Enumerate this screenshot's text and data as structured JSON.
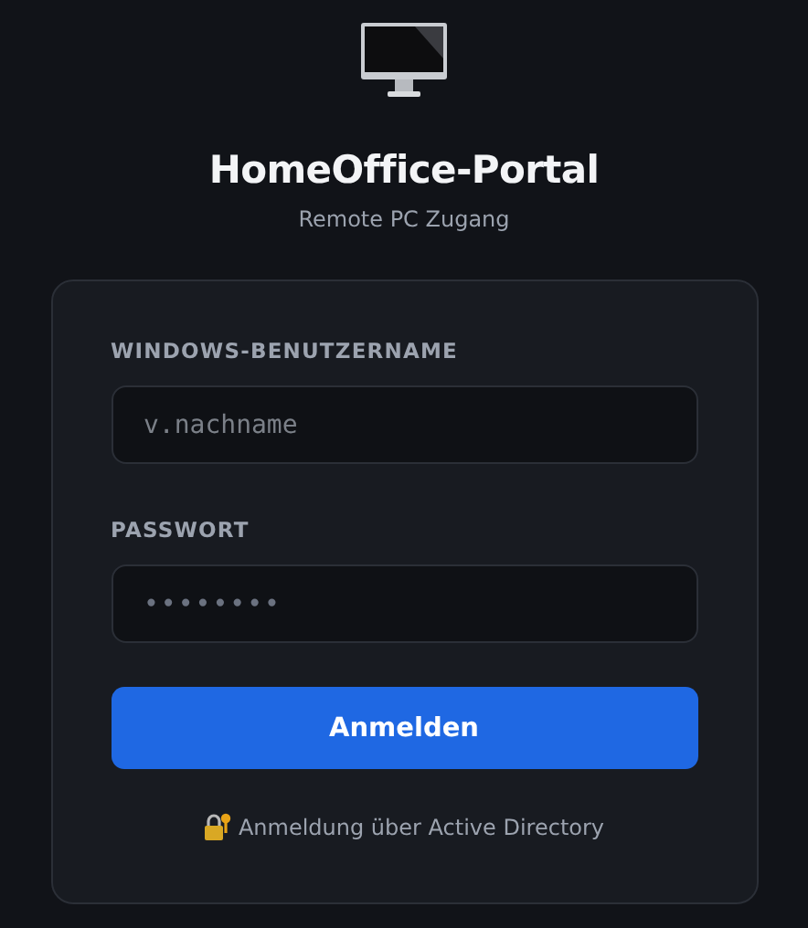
{
  "header": {
    "title": "HomeOffice-Portal",
    "subtitle": "Remote PC Zugang"
  },
  "fields": [
    {
      "label": "WINDOWS-BENUTZERNAME",
      "placeholder": "v.nachname",
      "kind": "text"
    },
    {
      "label": "PASSWORT",
      "placeholder": "••••••••",
      "kind": "password"
    }
  ],
  "submit": "Anmelden",
  "footer": "Anmeldung über Active Directory"
}
